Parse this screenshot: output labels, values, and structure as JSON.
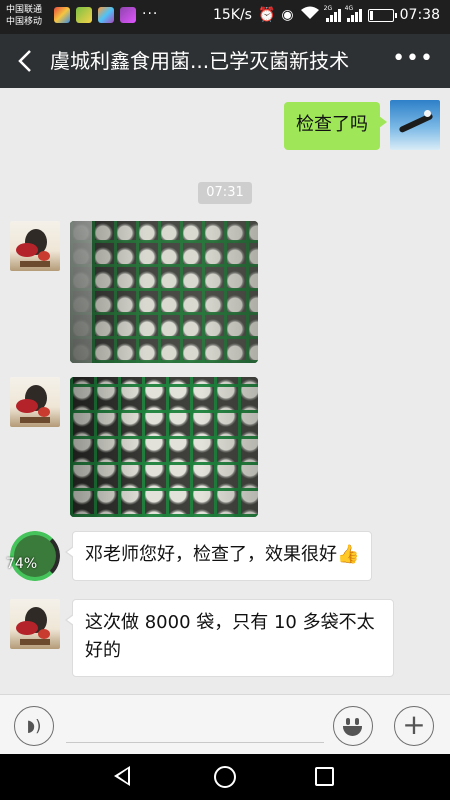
{
  "status_bar": {
    "carrier_1": "中国联通",
    "carrier_2": "中国移动",
    "speed": "15K/s",
    "network_1": "2G",
    "network_2": "4G",
    "time": "07:38",
    "battery_level": 0.15
  },
  "nav": {
    "title": "虞城利鑫食用菌...已学灭菌新技术"
  },
  "messages": [
    {
      "side": "right",
      "type": "text",
      "text": "检查了吗"
    },
    {
      "type": "timestamp",
      "text": "07:31"
    },
    {
      "side": "left",
      "type": "image"
    },
    {
      "side": "left",
      "type": "image"
    },
    {
      "side": "left",
      "type": "text",
      "text": "邓老师您好，检查了，效果很好",
      "emoji": "👍",
      "avatar_progress": "74%"
    },
    {
      "side": "left",
      "type": "text",
      "text": "这次做 8000 袋，只有 10 多袋不太好的"
    }
  ],
  "colors": {
    "nav_bg": "#2e3133",
    "chat_bg": "#ebebeb",
    "outgoing_bubble": "#9fe658",
    "incoming_bubble": "#ffffff"
  }
}
